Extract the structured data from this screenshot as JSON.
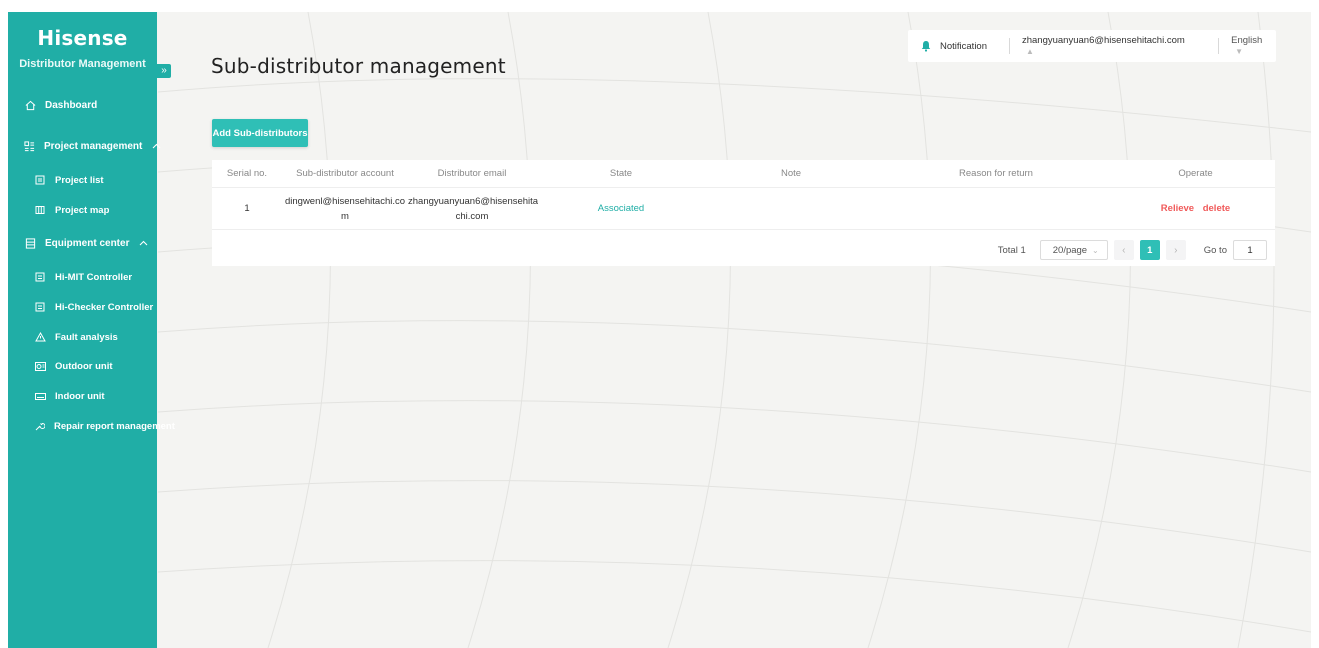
{
  "brand": {
    "logo": "Hisense",
    "subtitle": "Distributor Management",
    "accent": "#20aea6"
  },
  "sidebar": {
    "items": [
      {
        "label": "Dashboard",
        "icon": "home-icon"
      },
      {
        "label": "Project management",
        "icon": "grid-icon"
      },
      {
        "label": "Project list",
        "icon": "list-icon"
      },
      {
        "label": "Project map",
        "icon": "map-icon"
      },
      {
        "label": "Equipment center",
        "icon": "equipment-icon"
      },
      {
        "label": "Hi-MIT Controller",
        "icon": "controller-icon"
      },
      {
        "label": "Hi-Checker Controller",
        "icon": "controller-icon"
      },
      {
        "label": "Fault analysis",
        "icon": "warning-icon"
      },
      {
        "label": "Outdoor unit",
        "icon": "outdoor-unit-icon"
      },
      {
        "label": "Indoor unit",
        "icon": "indoor-unit-icon"
      },
      {
        "label": "Repair report management",
        "icon": "wrench-icon"
      }
    ]
  },
  "header": {
    "title": "Sub-distributor management",
    "notification": "Notification",
    "user": "zhangyuanyuan6@hisensehitachi.com",
    "language": "English"
  },
  "toolbar": {
    "add_label": "Add Sub-distributors"
  },
  "table": {
    "columns": [
      "Serial no.",
      "Sub-distributor account",
      "Distributor email",
      "State",
      "Note",
      "Reason for return",
      "Operate"
    ],
    "rows": [
      {
        "serial": "1",
        "account_line1": "dingwenl@hisensehitachi.co",
        "account_line2": "m",
        "email_line1": "zhangyuanyuan6@hisensehita",
        "email_line2": "chi.com",
        "state": "Associated",
        "note": "",
        "reason": "",
        "op_relieve": "Relieve",
        "op_delete": "delete"
      }
    ]
  },
  "pagination": {
    "total": "Total 1",
    "page_size": "20/page",
    "current_page": "1",
    "goto_label": "Go to",
    "goto_value": "1"
  }
}
